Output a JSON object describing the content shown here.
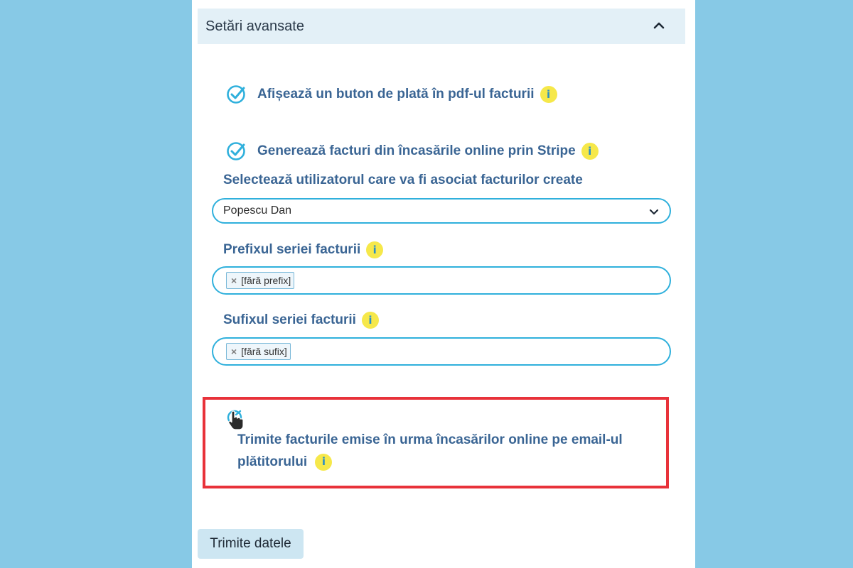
{
  "section": {
    "title": "Setări avansate"
  },
  "options": {
    "pay_button": {
      "label": "Afișează un buton de plată în pdf-ul facturii",
      "checked": true
    },
    "stripe_invoices": {
      "label": "Generează facturi din încasările online prin Stripe",
      "checked": true
    },
    "send_email": {
      "label_line1": "Trimite facturile emise în urma încasărilor online pe email-ul",
      "label_line2": "plătitorului"
    }
  },
  "user_select": {
    "label": "Selectează utilizatorul care va fi asociat facturilor create",
    "value": "Popescu Dan"
  },
  "prefix": {
    "label": "Prefixul seriei facturii",
    "tag": "[fără prefix]"
  },
  "suffix": {
    "label": "Sufixul seriei facturii",
    "tag": "[fără sufix]"
  },
  "info_glyph": "i",
  "tag_remove_glyph": "×",
  "submit": {
    "label": "Trimite datele"
  },
  "colors": {
    "background": "#87c9e6",
    "accent": "#2fb0dc",
    "label_text": "#3a6594",
    "info_badge": "#f6e84a",
    "highlight": "#e8323a",
    "button_bg": "#cde6f2"
  }
}
